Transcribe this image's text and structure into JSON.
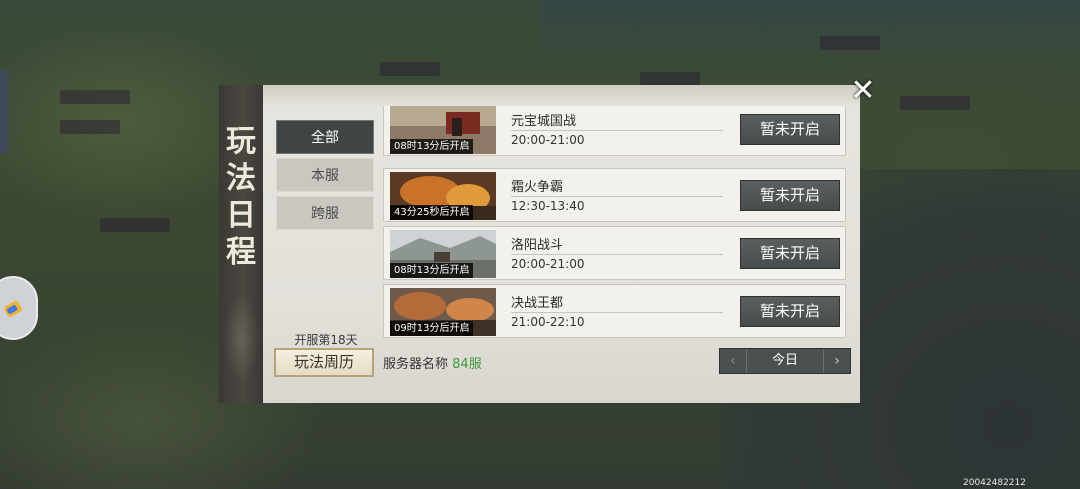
{
  "panel": {
    "title": "玩法日程",
    "close_icon": "close-icon"
  },
  "filters": [
    {
      "label": "全部",
      "active": true
    },
    {
      "label": "本服",
      "active": false
    },
    {
      "label": "跨服",
      "active": false
    }
  ],
  "server_day": "开服第18天",
  "calendar_button": "玩法周历",
  "server": {
    "label": "服务器名称",
    "value": "84服"
  },
  "date_nav": {
    "today": "今日",
    "prev_icon": "chevron-left-icon",
    "next_icon": "chevron-right-icon"
  },
  "events": [
    {
      "name": "元宝城国战",
      "time": "20:00-21:00",
      "countdown": "08时13分后开启",
      "status": "暂未开启"
    },
    {
      "name": "霜火争霸",
      "time": "12:30-13:40",
      "countdown": "43分25秒后开启",
      "status": "暂未开启"
    },
    {
      "name": "洛阳战斗",
      "time": "20:00-21:00",
      "countdown": "08时13分后开启",
      "status": "暂未开启"
    },
    {
      "name": "决战王都",
      "time": "21:00-22:10",
      "countdown": "09时13分后开启",
      "status": "暂未开启"
    }
  ],
  "watermark": "20042482212",
  "colors": {
    "panel_bg": "#e4e2dc",
    "banner_bg": "#3f3c37",
    "button_dark": "#4e5353",
    "server_value": "#3d9a3d"
  }
}
